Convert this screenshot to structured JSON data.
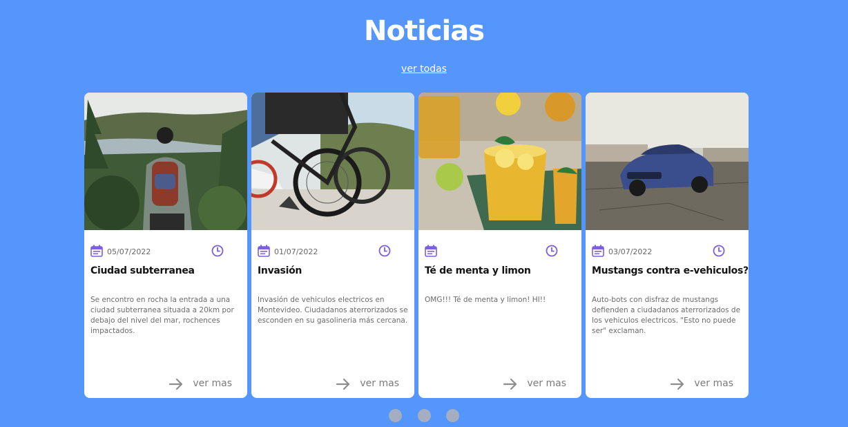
{
  "header": {
    "title": "Noticias",
    "see_all": "ver todas"
  },
  "cards": [
    {
      "image": "hiker-with-backpack-photo",
      "date": "05/07/2022",
      "title": "Ciudad subterranea",
      "text": "Se encontro en rocha la entrada a una ciudad subterranea situada a 20km por debajo del nivel del mar, rochences impactados.",
      "more_label": "ver mas"
    },
    {
      "image": "electric-bicycle-photo",
      "date": "01/07/2022",
      "title": "Invasión",
      "text": "Invasión de vehiculos electricos en Montevideo. Ciudadanos aterrorizados se esconden en su gasolineria más cercana.",
      "more_label": "ver mas"
    },
    {
      "image": "mint-lemon-tea-photo",
      "date": "",
      "title": "Té de menta y limon",
      "text": "OMG!!! Té de menta y limon! HI!!",
      "more_label": "ver mas"
    },
    {
      "image": "blue-muscle-car-photo",
      "date": "03/07/2022",
      "title": "Mustangs contra e-vehiculos?",
      "text": "Auto-bots con disfraz de mustangs defienden a ciudadanos aterrorizados de los vehiculos electricos. \"Esto no puede ser\" exclaman.",
      "more_label": "ver mas"
    }
  ],
  "carousel": {
    "page_count": 3
  },
  "colors": {
    "background": "#5496fb",
    "card": "#ffffff",
    "icon_accent": "#7b5fe0",
    "dot": "#a5aec0"
  }
}
